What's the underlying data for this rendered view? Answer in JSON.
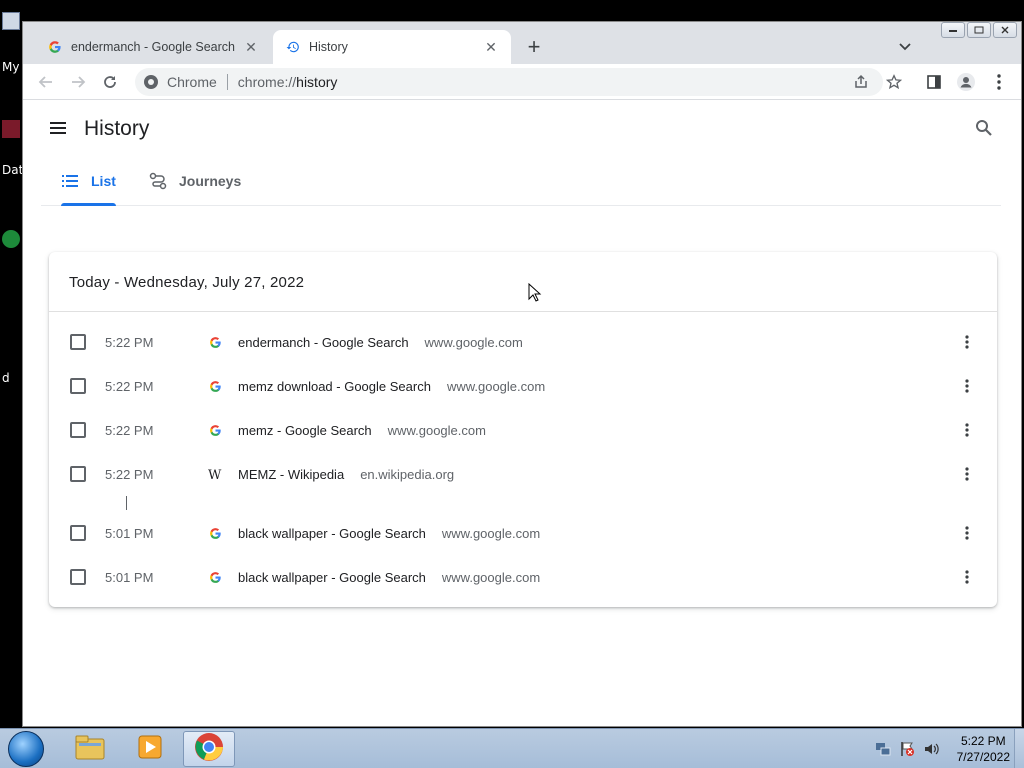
{
  "desktop": {
    "labels": [
      "My",
      "Dat",
      "d"
    ]
  },
  "browser": {
    "tabs": [
      {
        "title": "endermanch - Google Search",
        "active": false
      },
      {
        "title": "History",
        "active": true
      }
    ],
    "omnibox": {
      "chip": "Chrome",
      "url_scheme": "chrome://",
      "url_host": "history"
    }
  },
  "history": {
    "title": "History",
    "tabs": [
      {
        "label": "List",
        "active": true
      },
      {
        "label": "Journeys",
        "active": false
      }
    ],
    "day_header": "Today - Wednesday, July 27, 2022",
    "entries": [
      {
        "time": "5:22 PM",
        "icon": "google-icon",
        "title": "endermanch - Google Search",
        "domain": "www.google.com"
      },
      {
        "time": "5:22 PM",
        "icon": "google-icon",
        "title": "memz download - Google Search",
        "domain": "www.google.com"
      },
      {
        "time": "5:22 PM",
        "icon": "google-icon",
        "title": "memz - Google Search",
        "domain": "www.google.com"
      },
      {
        "time": "5:22 PM",
        "icon": "wikipedia-icon",
        "title": "MEMZ - Wikipedia",
        "domain": "en.wikipedia.org"
      },
      {
        "time": "5:01 PM",
        "icon": "google-icon",
        "title": "black wallpaper - Google Search",
        "domain": "www.google.com"
      },
      {
        "time": "5:01 PM",
        "icon": "google-icon",
        "title": "black wallpaper - Google Search",
        "domain": "www.google.com"
      }
    ]
  },
  "taskbar": {
    "clock_time": "5:22 PM",
    "clock_date": "7/27/2022"
  },
  "colors": {
    "accent": "#1a73e8",
    "tabstrip": "#dee1e6",
    "omnibox": "#f1f3f4"
  }
}
